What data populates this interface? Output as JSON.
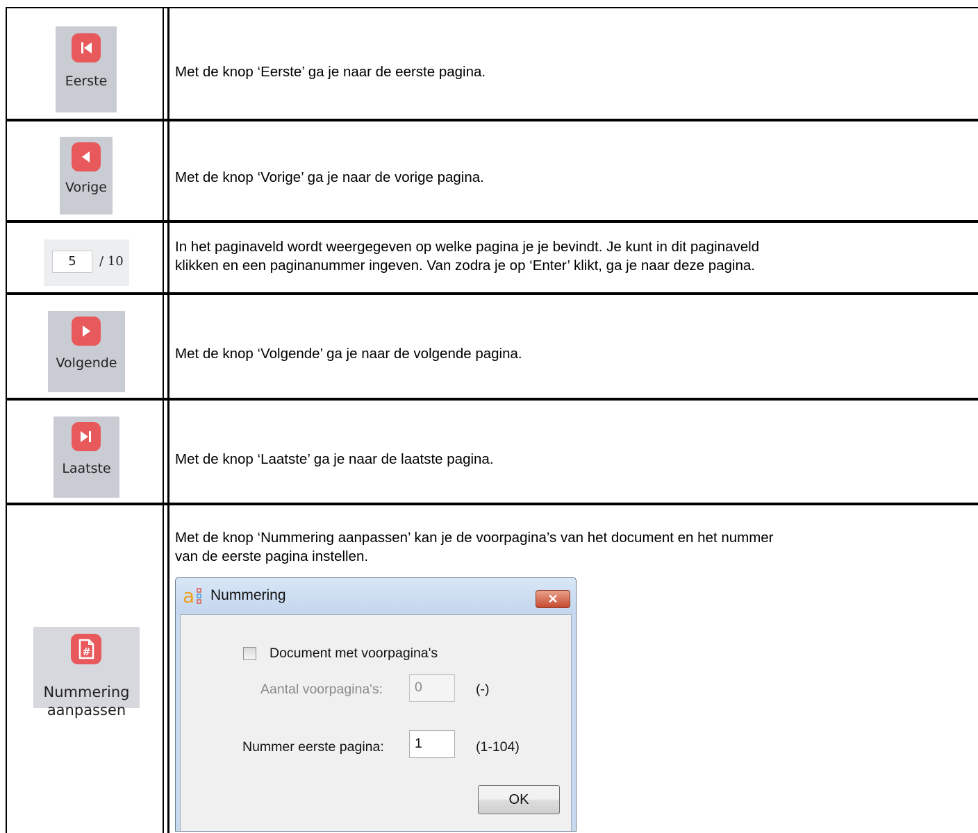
{
  "rows": [
    {
      "button_label": "Eerste",
      "icon": "first-page-icon",
      "description": "Met de knop ‘Eerste’ ga je naar de eerste pagina."
    },
    {
      "button_label": "Vorige",
      "icon": "previous-page-icon",
      "description": "Met de knop ‘Vorige’ ga je naar de vorige pagina."
    },
    {
      "page_field": {
        "current": "5",
        "total": "/ 10"
      },
      "description_lines": [
        "In het paginaveld wordt weergegeven op welke pagina je je bevindt. Je kunt in dit paginaveld",
        "klikken en een paginanummer ingeven. Van zodra je op ‘Enter’ klikt, ga je naar deze pagina."
      ]
    },
    {
      "button_label": "Volgende",
      "icon": "next-page-icon",
      "description": "Met de knop ‘Volgende’ ga je naar de volgende pagina."
    },
    {
      "button_label": "Laatste",
      "icon": "last-page-icon",
      "description": "Met de knop ‘Laatste’ ga je naar de laatste pagina."
    },
    {
      "button_label_lines": [
        "Nummering",
        "aanpassen"
      ],
      "icon": "page-numbering-icon",
      "description_lines": [
        "Met de knop ‘Nummering aanpassen’ kan je de voorpagina’s van het document en het nummer",
        "van de eerste pagina instellen."
      ]
    }
  ],
  "dialog": {
    "title": "Nummering",
    "close": "✕",
    "checkbox_label": "Document met voorpagina's",
    "checkbox_checked": false,
    "front_pages_label": "Aantal voorpagina's:",
    "front_pages_value": "0",
    "front_pages_range": "(-)",
    "first_page_label": "Nummer eerste pagina:",
    "first_page_value": "1",
    "first_page_range": "(1-104)",
    "ok_label": "OK"
  },
  "colors": {
    "accent_red": "#e8595c",
    "button_bg": "#c9ccd3",
    "dialog_frame": "#c8daf0"
  }
}
